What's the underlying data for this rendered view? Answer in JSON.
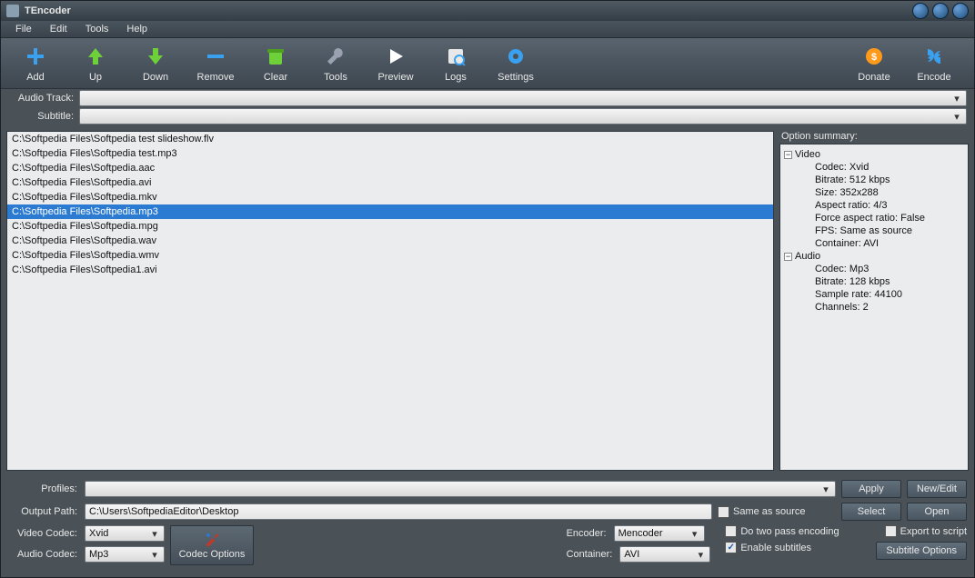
{
  "app": {
    "title": "TEncoder"
  },
  "menu": {
    "items": [
      "File",
      "Edit",
      "Tools",
      "Help"
    ]
  },
  "toolbar": {
    "items": [
      {
        "id": "add",
        "label": "Add",
        "icon": "plus"
      },
      {
        "id": "up",
        "label": "Up",
        "icon": "arrow-up"
      },
      {
        "id": "down",
        "label": "Down",
        "icon": "arrow-down"
      },
      {
        "id": "remove",
        "label": "Remove",
        "icon": "minus"
      },
      {
        "id": "clear",
        "label": "Clear",
        "icon": "trash"
      },
      {
        "id": "tools",
        "label": "Tools",
        "icon": "wrench"
      },
      {
        "id": "preview",
        "label": "Preview",
        "icon": "play"
      },
      {
        "id": "logs",
        "label": "Logs",
        "icon": "logs"
      },
      {
        "id": "settings",
        "label": "Settings",
        "icon": "gear"
      }
    ],
    "right": [
      {
        "id": "donate",
        "label": "Donate",
        "icon": "donate"
      },
      {
        "id": "encode",
        "label": "Encode",
        "icon": "encode"
      }
    ]
  },
  "track": {
    "audio_label": "Audio Track:",
    "audio_value": "",
    "subtitle_label": "Subtitle:",
    "subtitle_value": ""
  },
  "files": [
    "C:\\Softpedia Files\\Softpedia test slideshow.flv",
    "C:\\Softpedia Files\\Softpedia test.mp3",
    "C:\\Softpedia Files\\Softpedia.aac",
    "C:\\Softpedia Files\\Softpedia.avi",
    "C:\\Softpedia Files\\Softpedia.mkv",
    "C:\\Softpedia Files\\Softpedia.mp3",
    "C:\\Softpedia Files\\Softpedia.mpg",
    "C:\\Softpedia Files\\Softpedia.wav",
    "C:\\Softpedia Files\\Softpedia.wmv",
    "C:\\Softpedia Files\\Softpedia1.avi"
  ],
  "files_selected_index": 5,
  "summary": {
    "header": "Option summary:",
    "video_label": "Video",
    "video": {
      "codec": "Codec: Xvid",
      "bitrate": "Bitrate: 512 kbps",
      "size": "Size: 352x288",
      "aspect": "Aspect ratio: 4/3",
      "force_aspect": "Force aspect ratio: False",
      "fps": "FPS: Same as source",
      "container": "Container: AVI"
    },
    "audio_label": "Audio",
    "audio": {
      "codec": "Codec: Mp3",
      "bitrate": "Bitrate: 128 kbps",
      "sample": "Sample rate: 44100",
      "channels": "Channels: 2"
    }
  },
  "bottom": {
    "profiles_label": "Profiles:",
    "profiles_value": "",
    "apply": "Apply",
    "newedit": "New/Edit",
    "output_label": "Output Path:",
    "output_value": "C:\\Users\\SoftpediaEditor\\Desktop",
    "same_as_source": "Same as source",
    "select": "Select",
    "open": "Open",
    "video_codec_label": "Video Codec:",
    "video_codec_value": "Xvid",
    "audio_codec_label": "Audio Codec:",
    "audio_codec_value": "Mp3",
    "codec_options": "Codec Options",
    "encoder_label": "Encoder:",
    "encoder_value": "Mencoder",
    "container_label": "Container:",
    "container_value": "AVI",
    "two_pass": "Do two pass encoding",
    "export_script": "Export to script",
    "enable_subs": "Enable subtitles",
    "subtitle_options": "Subtitle Options"
  },
  "colors": {
    "sel": "#2a7bd1"
  }
}
